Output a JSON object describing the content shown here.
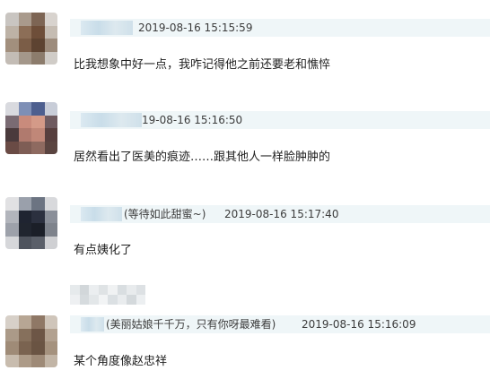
{
  "comments": [
    {
      "name_suffix": "",
      "timestamp": "2019-08-16 15:15:59",
      "text": "比我想象中好一点，我咋记得他之前还要老和憔悴",
      "avatar_colors": [
        "#c9c5c1",
        "#a99a8c",
        "#7d6554",
        "#d8d3ce",
        "#bdb2a6",
        "#8c6e57",
        "#6e4e39",
        "#c5bcb2",
        "#a28f7d",
        "#7b5d47",
        "#5d4331",
        "#9d8c7c",
        "#c3bcb5",
        "#a4978a",
        "#8c7c6c",
        "#d0ccc7"
      ]
    },
    {
      "name_suffix": "",
      "timestamp": "19-08-16 15:16:50",
      "text": "居然看出了医美的痕迹……跟其他人一样脸肿肿的",
      "avatar_colors": [
        "#d9dadf",
        "#7e8fb6",
        "#4d5f8f",
        "#c8cdd8",
        "#7a6b73",
        "#c98b7c",
        "#d49a88",
        "#6f5b60",
        "#4a3a3c",
        "#b07a6e",
        "#c08778",
        "#573f3e",
        "#6a4b45",
        "#7e5d55",
        "#8e6a60",
        "#5a4440"
      ]
    },
    {
      "name_suffix": "(等待如此甜蜜~)",
      "timestamp": "2019-08-16 15:17:40",
      "text": "有点姨化了",
      "avatar_colors": [
        "#e1e1e3",
        "#9aa0ab",
        "#6c7482",
        "#d8d9dc",
        "#b2b5bc",
        "#1f2431",
        "#2b303f",
        "#8a8f99",
        "#9da1aa",
        "#20252f",
        "#1b1f28",
        "#7e838c",
        "#d6d7da",
        "#4e535d",
        "#5a5f69",
        "#cfd0d3"
      ]
    },
    {
      "name_suffix": "(美丽姑娘千千万，只有你呀最难看)",
      "timestamp": "2019-08-16 15:16:09",
      "text": "某个角度像赵忠祥",
      "avatar_colors": [
        "#d7d0c8",
        "#b7a694",
        "#8f7866",
        "#cfc5ba",
        "#ab9a88",
        "#86705c",
        "#6d5646",
        "#b2a190",
        "#9f8b77",
        "#7a6350",
        "#6a5443",
        "#a5927e",
        "#c8bcae",
        "#ad9b88",
        "#9e8a77",
        "#c2b5a6"
      ]
    }
  ],
  "reply_blur_colors": [
    "#e6eaec",
    "#d2d7da",
    "#ebeef0",
    "#dfe3e5",
    "#f0f2f3",
    "#d9dee1",
    "#e8ebed",
    "#dde1e4",
    "#eef0f2",
    "#d6dbde",
    "#e3e7e9",
    "#f2f4f5",
    "#dbe0e3",
    "#e9ecee",
    "#d4d9dc",
    "#eceff1"
  ]
}
